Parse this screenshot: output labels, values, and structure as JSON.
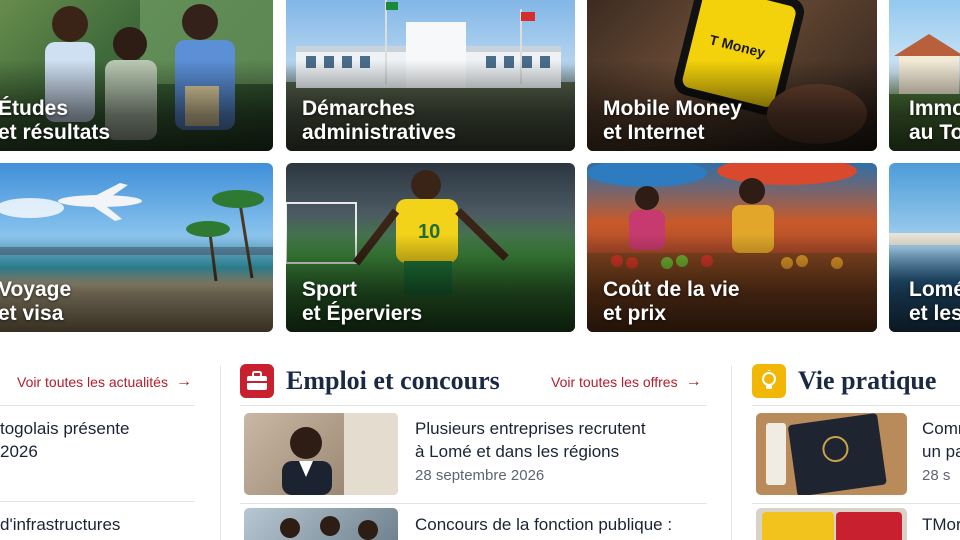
{
  "tiles": [
    {
      "id": "etudes",
      "line1": "Études",
      "line2": "et résultats"
    },
    {
      "id": "demarches",
      "line1": "Démarches",
      "line2": "administratives"
    },
    {
      "id": "money",
      "line1": "Mobile Money",
      "line2": "et Internet"
    },
    {
      "id": "immo",
      "line1": "Immo",
      "line2": "au To"
    },
    {
      "id": "voyage",
      "line1": "Voyage",
      "line2": "et visa"
    },
    {
      "id": "sport",
      "line1": "Sport",
      "line2": "et Éperviers"
    },
    {
      "id": "cout",
      "line1": "Coût de la vie",
      "line2": "et prix"
    },
    {
      "id": "lome",
      "line1": "Lomé",
      "line2": "et les"
    }
  ],
  "phone_brand": "T Money",
  "player_number": "10",
  "news": {
    "link_label": "Voir toutes les actualités",
    "items": [
      {
        "title_line1": "togolais présente",
        "title_line2": "2026"
      },
      {
        "title_line1": "d'infrastructures",
        "title_line2": ""
      }
    ]
  },
  "emploi": {
    "title": "Emploi et concours",
    "link_label": "Voir toutes les offres",
    "items": [
      {
        "title_line1": "Plusieurs entreprises recrutent",
        "title_line2": "à Lomé et dans les régions",
        "date": "28 septembre 2026"
      },
      {
        "title_line1": "Concours de la fonction publique :",
        "title_line2": "",
        "date": ""
      }
    ]
  },
  "pratique": {
    "title": "Vie pratique",
    "items": [
      {
        "title_line1": "Comr",
        "title_line2": "un pa",
        "date": "28 s"
      },
      {
        "title_line1": "TMor",
        "title_line2": "",
        "date": ""
      }
    ]
  },
  "colors": {
    "accent_red": "#b31c2c",
    "emploi_icon_bg": "#c8202f",
    "pratique_icon_bg": "#f2b705",
    "title_navy": "#1b2a44"
  },
  "icons": {
    "emploi": "briefcase-icon",
    "pratique": "lightbulb-icon",
    "arrow": "arrow-right-icon"
  }
}
